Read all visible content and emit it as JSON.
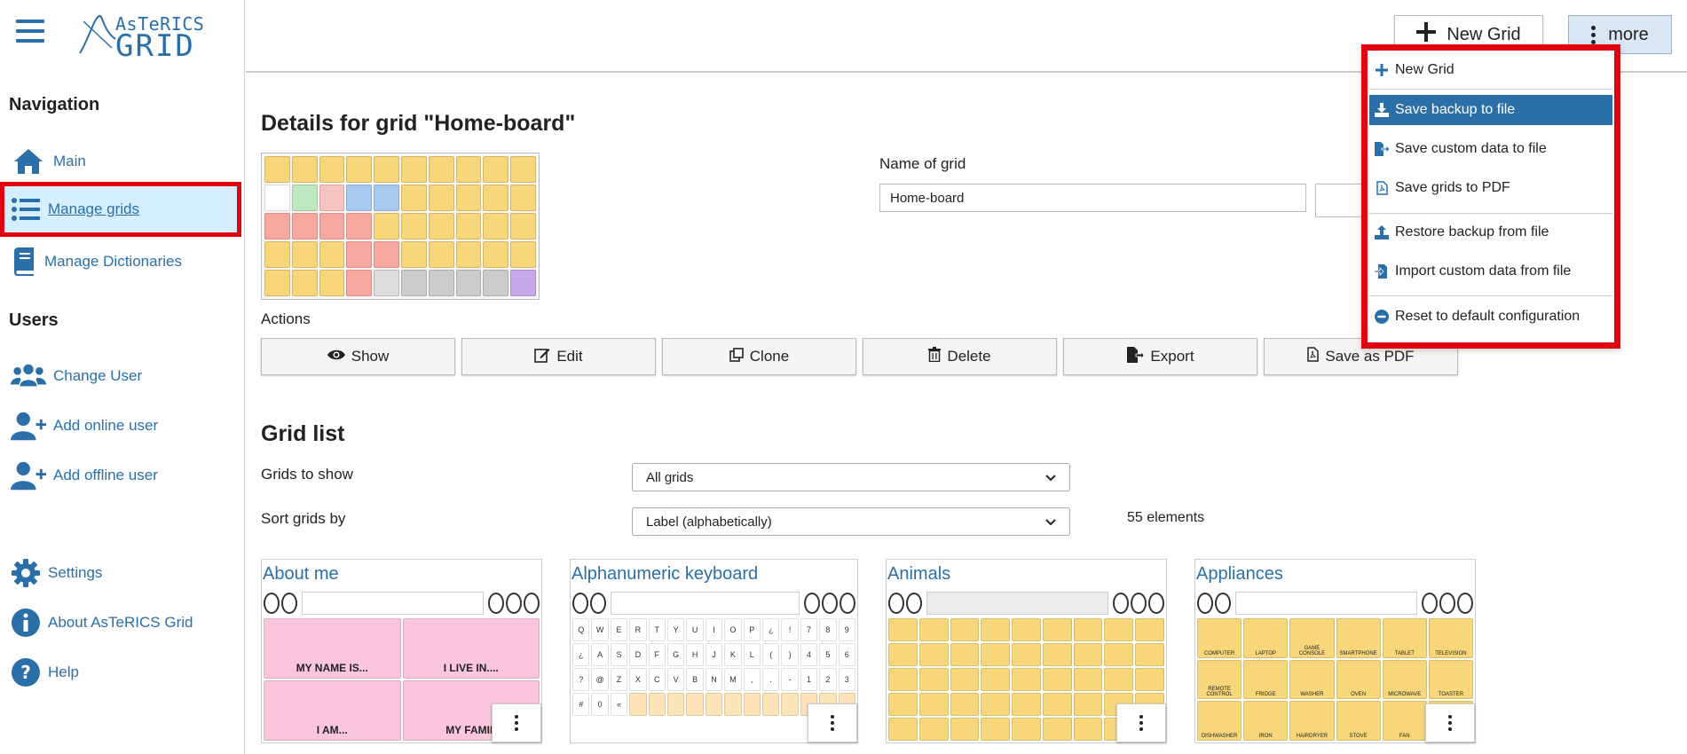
{
  "app": {
    "logo_top": "AsTeRICS",
    "logo_bottom": "GRID"
  },
  "sidebar": {
    "navigation_heading": "Navigation",
    "nav_items": [
      {
        "label": "Main",
        "icon": "home-icon"
      },
      {
        "label": "Manage grids",
        "icon": "list-icon",
        "active": true
      },
      {
        "label": "Manage Dictionaries",
        "icon": "book-icon"
      }
    ],
    "users_heading": "Users",
    "user_items": [
      {
        "label": "Change User",
        "icon": "users-icon"
      },
      {
        "label": "Add online user",
        "icon": "user-plus-icon"
      },
      {
        "label": "Add offline user",
        "icon": "user-plus-icon"
      }
    ],
    "bottom_items": [
      {
        "label": "Settings",
        "icon": "gear-icon"
      },
      {
        "label": "About AsTeRICS Grid",
        "icon": "info-icon"
      },
      {
        "label": "Help",
        "icon": "question-icon"
      }
    ]
  },
  "header": {
    "new_grid_label": "New Grid",
    "more_label": "more"
  },
  "dropdown": {
    "items": [
      {
        "label": "New Grid",
        "icon": "plus-icon"
      },
      {
        "label": "Save backup to file",
        "icon": "download-icon",
        "active": true
      },
      {
        "label": "Save custom data to file",
        "icon": "file-export-icon"
      },
      {
        "label": "Save grids to PDF",
        "icon": "pdf-icon"
      },
      {
        "label": "Restore backup from file",
        "icon": "upload-icon"
      },
      {
        "label": "Import custom data from file",
        "icon": "file-import-icon"
      },
      {
        "label": "Reset to default configuration",
        "icon": "minus-circle-icon"
      }
    ]
  },
  "details": {
    "title": "Details for grid \"Home-board\"",
    "name_label": "Name of grid",
    "name_value": "Home-board",
    "actions_label": "Actions",
    "actions": [
      {
        "label": "Show",
        "icon": "eye-icon"
      },
      {
        "label": "Edit",
        "icon": "edit-icon"
      },
      {
        "label": "Clone",
        "icon": "clone-icon"
      },
      {
        "label": "Delete",
        "icon": "trash-icon"
      },
      {
        "label": "Export",
        "icon": "file-export-icon"
      },
      {
        "label": "Save as PDF",
        "icon": "pdf-icon"
      }
    ]
  },
  "grid_list": {
    "title": "Grid list",
    "show_label": "Grids to show",
    "show_value": "All grids",
    "sort_label": "Sort grids by",
    "sort_value": "Label (alphabetically)",
    "count": "55 elements",
    "cards": [
      {
        "title": "About me",
        "cells": [
          "MY NAME IS...",
          "I LIVE IN....",
          "I AM...",
          "MY FAMIL"
        ]
      },
      {
        "title": "Alphanumeric keyboard",
        "keys": [
          "Q",
          "W",
          "E",
          "R",
          "T",
          "Y",
          "U",
          "I",
          "O",
          "P",
          "¿",
          "!",
          "7",
          "8",
          "9",
          "¿",
          "A",
          "S",
          "D",
          "F",
          "G",
          "H",
          "J",
          "K",
          "L",
          "(",
          ")",
          "4",
          "5",
          "6",
          "?",
          "@",
          "Z",
          "X",
          "C",
          "V",
          "B",
          "N",
          "M",
          ",",
          ".",
          "-",
          "1",
          "2",
          "3",
          "#",
          "0",
          "«"
        ]
      },
      {
        "title": "Animals"
      },
      {
        "title": "Appliances",
        "cells": [
          "COMPUTER",
          "LAPTOP",
          "GAME CONSOLE",
          "SMARTPHONE",
          "TABLET",
          "TELEVISION",
          "REMOTE CONTROL",
          "FRIDGE",
          "WASHER",
          "OVEN",
          "MICROWAVE",
          "TOASTER",
          "DISHWASHER",
          "IRON",
          "HAIRDRYER",
          "STOVE",
          "FAN",
          ""
        ]
      }
    ]
  },
  "colors": {
    "accent": "#2b6fa8",
    "highlight_red": "#e0000f",
    "active_nav_bg": "#d5efff"
  }
}
